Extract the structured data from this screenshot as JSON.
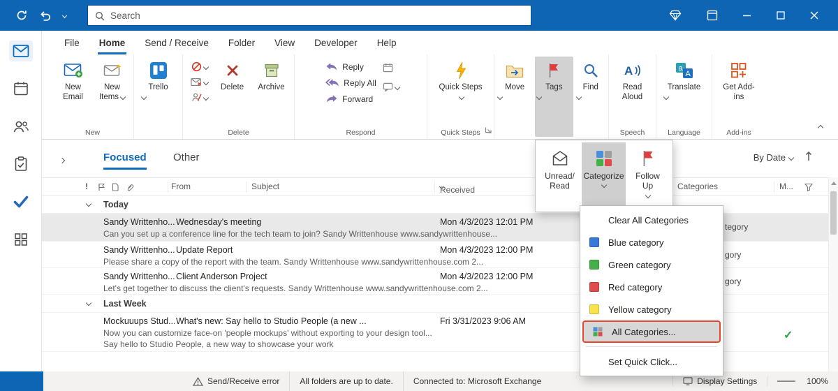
{
  "titlebar": {
    "search_placeholder": "Search"
  },
  "ribbon": {
    "tabs": [
      "File",
      "Home",
      "Send / Receive",
      "Folder",
      "View",
      "Developer",
      "Help"
    ],
    "buttons": {
      "new_email": "New Email",
      "new_items": "New Items",
      "trello": "Trello",
      "delete": "Delete",
      "archive": "Archive",
      "reply": "Reply",
      "reply_all": "Reply All",
      "forward": "Forward",
      "quick_steps": "Quick Steps",
      "move": "Move",
      "tags": "Tags",
      "find": "Find",
      "read_aloud": "Read Aloud",
      "translate": "Translate",
      "get_addins": "Get Add-ins"
    },
    "group_labels": {
      "new": "New",
      "delete": "Delete",
      "respond": "Respond",
      "quick_steps": "Quick Steps",
      "speech": "Speech",
      "language": "Language",
      "addins": "Add-ins"
    }
  },
  "tags_menu": {
    "unread_read": "Unread/ Read",
    "categorize": "Categorize",
    "follow_up": "Follow Up"
  },
  "categorize_menu": {
    "clear": "Clear All Categories",
    "blue": {
      "label": "Blue category",
      "color": "#3878d8"
    },
    "green": {
      "label": "Green category",
      "color": "#45b04a"
    },
    "red": {
      "label": "Red category",
      "color": "#e04c4c"
    },
    "yellow": {
      "label": "Yellow category",
      "color": "#f9e34b"
    },
    "all": "All Categories...",
    "quick_click": "Set Quick Click...",
    "highlight_border": "#e8452e"
  },
  "list": {
    "tab_focused": "Focused",
    "tab_other": "Other",
    "sort_label": "By Date",
    "columns": {
      "importance": "!",
      "from": "From",
      "subject": "Subject",
      "received": "Received",
      "categories": "Categories",
      "mentions": "M..."
    },
    "groups": [
      {
        "label": "Today",
        "emails": [
          {
            "from": "Sandy Writtenho...",
            "subject": "Wednesday's meeting",
            "received": "Mon 4/3/2023 12:01 PM",
            "preview": "Can you set up a conference line for the tech team to join?  Sandy Writtenhouse  www.sandywrittenhouse...",
            "category_partial": "tegory"
          },
          {
            "from": "Sandy Writtenho...",
            "subject": "Update Report",
            "received": "Mon 4/3/2023 12:00 PM",
            "preview": "Please share a copy of the report with the team.  Sandy Writtenhouse  www.sandywrittenhouse.com  2...",
            "category_partial": "gory"
          },
          {
            "from": "Sandy Writtenho...",
            "subject": "Client Anderson Project",
            "received": "Mon 4/3/2023 12:00 PM",
            "preview": "Let's get together to discuss the client's requests.  Sandy Writtenhouse  www.sandywrittenhouse.com  2...",
            "category_partial": "gory"
          }
        ]
      },
      {
        "label": "Last Week",
        "emails": [
          {
            "from": "Mockuuups Stud...",
            "subject": "What's new: Say hello to Studio People (a new ...",
            "received": "Fri 3/31/2023 9:06 AM",
            "preview": "Now you can customize face-on 'people mockups' without exporting to your design tool...",
            "preview2": "Say hello to Studio People, a new way to showcase your work"
          }
        ]
      }
    ]
  },
  "statusbar": {
    "error": "Send/Receive error",
    "folders": "All folders are up to date.",
    "connected": "Connected to: Microsoft Exchange",
    "display_settings": "Display Settings",
    "zoom": "100%"
  }
}
